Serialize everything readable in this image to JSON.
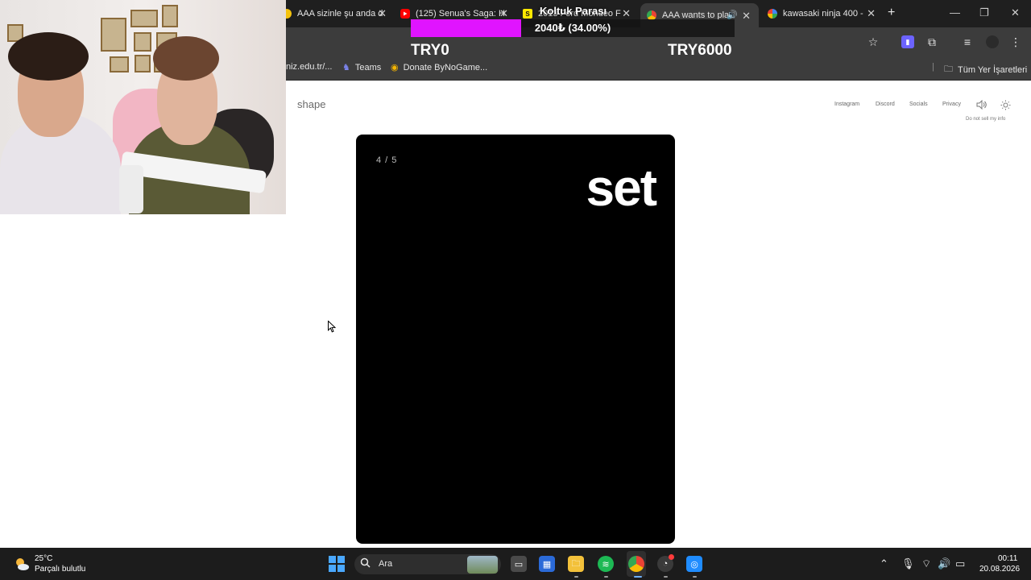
{
  "browser": {
    "tabs": [
      {
        "title": "AAA sizinle şu anda d",
        "favicon": "chrome-icon"
      },
      {
        "title": "(125) Senua's Saga: H",
        "favicon": "youtube-icon"
      },
      {
        "title": "2013 Ford Mondeo F",
        "favicon": "sahibinden-icon"
      },
      {
        "title": "AAA wants to pla",
        "favicon": "chrome-icon",
        "active": true
      },
      {
        "title": "kawasaki ninja 400 -",
        "favicon": "google-icon"
      }
    ],
    "url_partial": "niz.edu.tr/...",
    "bookmarks": [
      {
        "label": "Teams",
        "icon": "teams-icon"
      },
      {
        "label": "Donate ByNoGame...",
        "icon": "donate-icon"
      }
    ],
    "all_bookmarks_label": "Tüm Yer İşaretleri"
  },
  "overlay": {
    "title": "Koltuk Parası",
    "progress_text": "2040₺ (34.00%)",
    "progress_fraction": 0.34,
    "min_label": "TRY0",
    "max_label": "TRY6000",
    "fill_color": "#e014ff"
  },
  "page": {
    "logo": "shape",
    "nav": [
      "Instagram",
      "Discord",
      "Socials",
      "Privacy"
    ],
    "do_not_sell": "Do not sell my info",
    "card": {
      "counter": "4 / 5",
      "word": "set"
    }
  },
  "taskbar": {
    "weather_temp": "25°C",
    "weather_desc": "Parçalı bulutlu",
    "search_placeholder": "Ara",
    "time": "00:11",
    "date": "20.08.2026"
  }
}
